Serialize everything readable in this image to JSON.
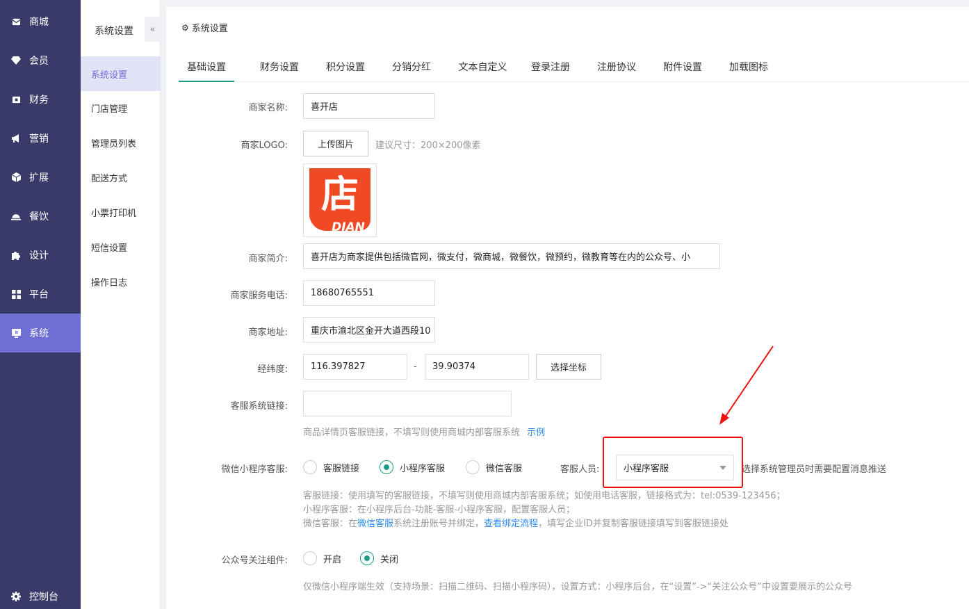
{
  "sidebar": {
    "items": [
      {
        "label": "商城",
        "icon": "envelope-icon"
      },
      {
        "label": "会员",
        "icon": "diamond-icon"
      },
      {
        "label": "财务",
        "icon": "wallet-icon"
      },
      {
        "label": "营销",
        "icon": "megaphone-icon"
      },
      {
        "label": "扩展",
        "icon": "cube-icon"
      },
      {
        "label": "餐饮",
        "icon": "cloche-icon"
      },
      {
        "label": "设计",
        "icon": "puzzle-icon"
      },
      {
        "label": "平台",
        "icon": "grid-icon"
      },
      {
        "label": "系统",
        "icon": "monitor-icon"
      }
    ],
    "bottom": {
      "label": "控制台",
      "icon": "gear-icon"
    }
  },
  "subnav": {
    "title": "系统设置",
    "collapse": "«",
    "items": [
      "系统设置",
      "门店管理",
      "管理员列表",
      "配送方式",
      "小票打印机",
      "短信设置",
      "操作日志"
    ]
  },
  "main": {
    "title": "系统设置",
    "tabs": [
      "基础设置",
      "财务设置",
      "积分设置",
      "分销分红",
      "文本自定义",
      "登录注册",
      "注册协议",
      "附件设置",
      "加载图标"
    ]
  },
  "form": {
    "name_label": "商家名称:",
    "name_value": "喜开店",
    "logo_label": "商家LOGO:",
    "upload_label": "上传图片",
    "logo_hint": "建议尺寸：200×200像素",
    "logo_text": "DIAN",
    "logo_glyph": "店",
    "intro_label": "商家简介:",
    "intro_value": "喜开店为商家提供包括微官网，微支付，微商城，微餐饮，微预约，微教育等在内的公众号、小",
    "phone_label": "商家服务电话:",
    "phone_value": "18680765551",
    "address_label": "商家地址:",
    "address_value": "重庆市渝北区金开大道西段10",
    "coord_label": "经纬度:",
    "lng_value": "116.397827",
    "coord_sep": "-",
    "lat_value": "39.90374",
    "coord_button": "选择坐标",
    "cs_link_label": "客服系统链接:",
    "cs_link_value": "",
    "cs_link_hint": "商品详情页客服链接，不填写则使用商城内部客服系统",
    "cs_link_example": "示例",
    "mini_label": "微信小程序客服:",
    "mini_options": [
      "客服链接",
      "小程序客服",
      "微信客服"
    ],
    "staff_label": "客服人员:",
    "staff_value": "小程序客服",
    "staff_hint": "选择系统管理员时需要配置消息推送",
    "desc1": "客服链接：使用填写的客服链接，不填写则使用商城内部客服系统；如使用电话客服，链接格式为：tel:0539-123456；",
    "desc2": "小程序客服：在小程序后台-功能-客服-小程序客服，配置客服人员；",
    "desc3_a": "微信客服：在",
    "desc3_link1": "微信客服",
    "desc3_b": "系统注册账号并绑定，",
    "desc3_link2": "查看绑定流程",
    "desc3_c": "，填写企业ID并复制客服链接填写到客服链接处",
    "follow_label": "公众号关注组件:",
    "follow_options": [
      "开启",
      "关闭"
    ],
    "follow_hint": "仅微信小程序端生效（支持场景：扫描二维码、扫描小程序码），设置方式：小程序后台，在“设置”->“关注公众号”中设置要展示的公众号"
  },
  "colors": {
    "sidebar": "#3a3a6a",
    "active": "#6f6fd6",
    "accent": "#1a9e86",
    "highlight": "#ee1111",
    "logo": "#f04a25"
  }
}
